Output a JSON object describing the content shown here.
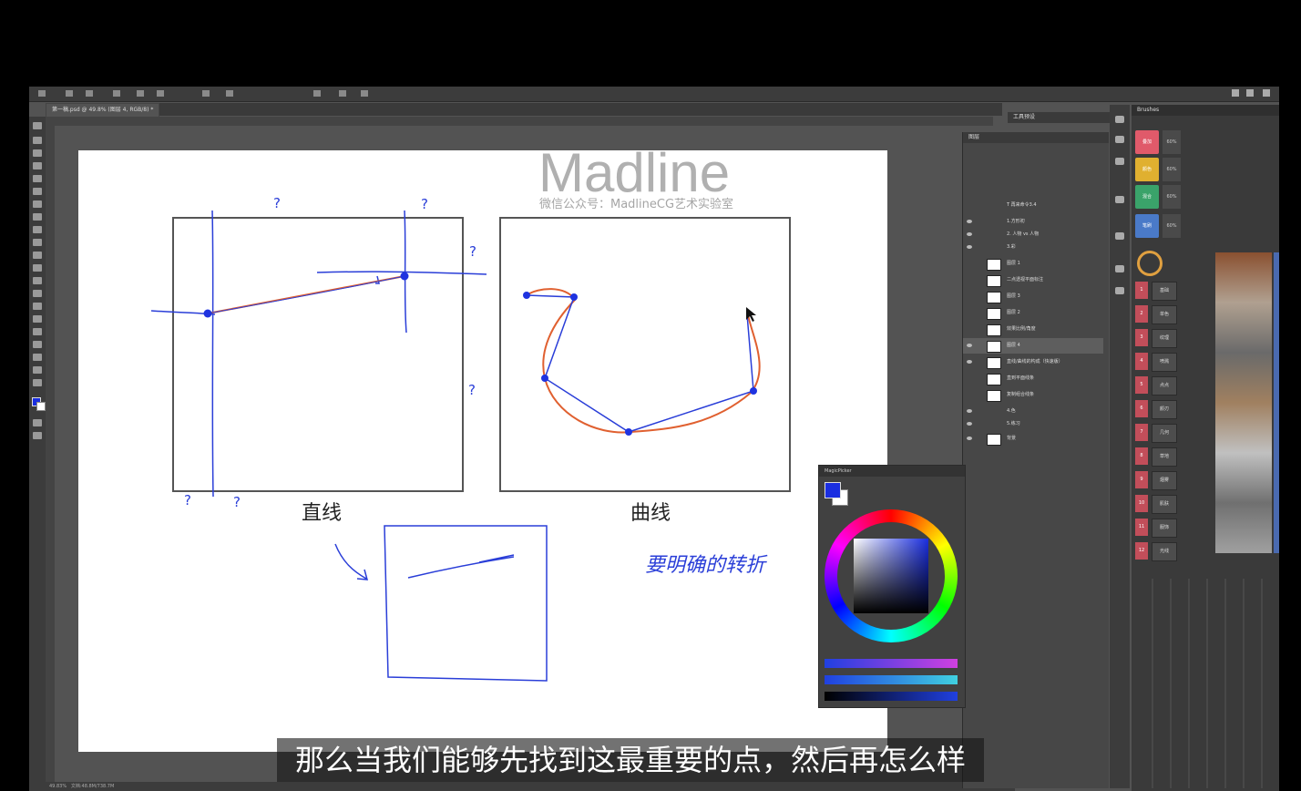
{
  "document": {
    "tab_label": "第一稿.psd @ 49.8% (图层 4, RGB/8) *",
    "zoom_status": "49.83%",
    "doc_size": "文档:48.8M/738.7M"
  },
  "panels": {
    "tools_note": "工具预设",
    "layers_tab": "图层",
    "brushes_tab": "Brushes",
    "magic_tab": "MagicPicker"
  },
  "layers": [
    {
      "name": "T  再来命令3.4"
    },
    {
      "name": "1.方形初"
    },
    {
      "name": "2. 人物 vs 人物"
    },
    {
      "name": "3.彩"
    },
    {
      "name": "图层 1"
    },
    {
      "name": "二点透视平面标注"
    },
    {
      "name": "图层 3"
    },
    {
      "name": "图层 2"
    },
    {
      "name": "效果比例/角度"
    },
    {
      "name": "图层 4"
    },
    {
      "name": "直线/曲线的构成（快速版）"
    },
    {
      "name": "直到平面线条"
    },
    {
      "name": "复制组合线条"
    },
    {
      "name": "4.色"
    },
    {
      "name": "5.练习"
    },
    {
      "name": "背景"
    }
  ],
  "watermark": {
    "logo": "Madline",
    "caption": "微信公众号：MadlineCG艺术实验室"
  },
  "drawing": {
    "label_straight": "直线",
    "label_curve": "曲线",
    "note_handwritten": "要明确的转折",
    "question_mark": "?"
  },
  "brush_colors": [
    {
      "label": "叠加",
      "color": "#e05a6a"
    },
    {
      "label": "颜色",
      "color": "#e0b030"
    },
    {
      "label": "混合",
      "color": "#3aa36a"
    },
    {
      "label": "笔刷",
      "color": "#4a7ac8"
    }
  ],
  "brush_rows": [
    {
      "num": "1",
      "name": "基础"
    },
    {
      "num": "2",
      "name": "单色"
    },
    {
      "num": "3",
      "name": "纹理"
    },
    {
      "num": "4",
      "name": "喷溅"
    },
    {
      "num": "5",
      "name": "点点"
    },
    {
      "num": "6",
      "name": "颜刃"
    },
    {
      "num": "7",
      "name": "几何"
    },
    {
      "num": "8",
      "name": "草地"
    },
    {
      "num": "9",
      "name": "烟雾"
    },
    {
      "num": "10",
      "name": "肌肤"
    },
    {
      "num": "11",
      "name": "服饰"
    },
    {
      "num": "12",
      "name": "光线"
    }
  ],
  "color_picker": {
    "foreground": "#1a2ee0",
    "background": "#ffffff"
  },
  "subtitle": "那么当我们能够先找到这最重要的点，然后再怎么样"
}
